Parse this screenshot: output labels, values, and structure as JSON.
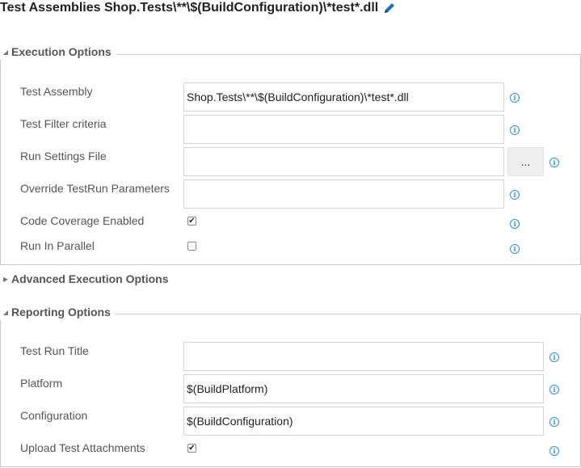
{
  "title": "Test Assemblies Shop.Tests\\**\\$(BuildConfiguration)\\*test*.dll",
  "icons": {
    "edit": "pencil-icon",
    "info": "info-icon",
    "expanded": "triangle-down-icon",
    "collapsed": "triangle-right-icon"
  },
  "accent_color": "#2b8fd6",
  "execution": {
    "heading": "Execution Options",
    "test_assembly": {
      "label": "Test Assembly",
      "value": "Shop.Tests\\**\\$(BuildConfiguration)\\*test*.dll"
    },
    "test_filter": {
      "label": "Test Filter criteria",
      "value": ""
    },
    "run_settings": {
      "label": "Run Settings File",
      "value": "",
      "browse_label": "..."
    },
    "override_params": {
      "label": "Override TestRun Parameters",
      "value": ""
    },
    "code_coverage": {
      "label": "Code Coverage Enabled",
      "checked": true
    },
    "run_parallel": {
      "label": "Run In Parallel",
      "checked": false
    }
  },
  "advanced": {
    "heading": "Advanced Execution Options"
  },
  "reporting": {
    "heading": "Reporting Options",
    "test_run_title": {
      "label": "Test Run Title",
      "value": ""
    },
    "platform": {
      "label": "Platform",
      "value": "$(BuildPlatform)"
    },
    "configuration": {
      "label": "Configuration",
      "value": "$(BuildConfiguration)"
    },
    "upload_attachments": {
      "label": "Upload Test Attachments",
      "checked": true
    }
  }
}
